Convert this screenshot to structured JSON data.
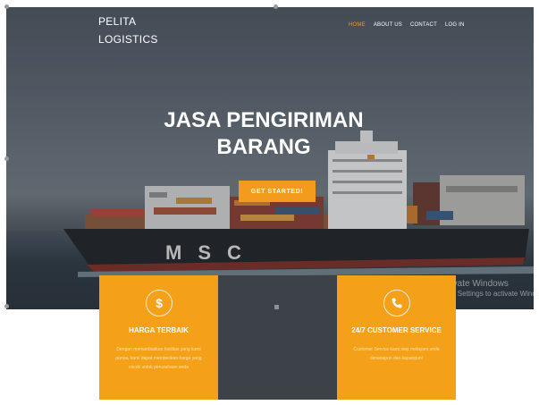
{
  "header": {
    "brand_line1": "PELITA",
    "brand_line2": "LOGISTICS",
    "nav": [
      {
        "label": "HOME",
        "active": true
      },
      {
        "label": "ABOUT US",
        "active": false
      },
      {
        "label": "CONTACT",
        "active": false
      },
      {
        "label": "LOG IN",
        "active": false
      }
    ]
  },
  "hero": {
    "title_line1": "JASA PENGIRIMAN",
    "title_line2": "BARANG",
    "cta_label": "GET STARTED!",
    "ship_name": "MSC"
  },
  "watermark": {
    "line1": "Activate Windows",
    "line2": "Go to Settings to activate Windows."
  },
  "features": [
    {
      "icon": "dollar-icon",
      "title": "HARGA TERBAIK",
      "desc": "Dengan memanfaatkan fasilitas yang kami punya, kami dapat memberikan harga yang cocok untuk perusahaan anda"
    },
    {
      "icon": "phone-icon",
      "title": "24/7 CUSTOMER SERVICE",
      "desc": "Customer Service kami siap melayani anda dimanapun dan kapanpun!"
    }
  ],
  "colors": {
    "accent": "#f29b1c",
    "card_orange": "#f4a019",
    "card_dark": "#3d4248"
  }
}
